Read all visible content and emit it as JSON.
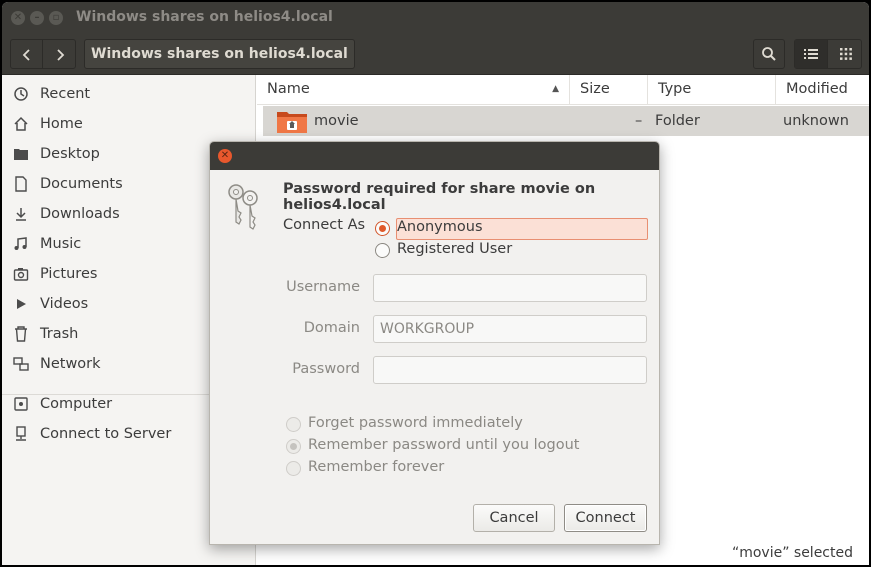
{
  "window": {
    "title": "Windows shares on helios4.local"
  },
  "toolbar": {
    "back_icon": "chevron-left-icon",
    "forward_icon": "chevron-right-icon",
    "path_label": "Windows shares on helios4.local",
    "search_icon": "search-icon",
    "list_view_icon": "list-view-icon",
    "grid_view_icon": "grid-view-icon"
  },
  "sidebar": {
    "items": [
      {
        "label": "Recent",
        "icon": "clock-icon"
      },
      {
        "label": "Home",
        "icon": "home-icon"
      },
      {
        "label": "Desktop",
        "icon": "folder-icon"
      },
      {
        "label": "Documents",
        "icon": "document-icon"
      },
      {
        "label": "Downloads",
        "icon": "download-icon"
      },
      {
        "label": "Music",
        "icon": "music-icon"
      },
      {
        "label": "Pictures",
        "icon": "camera-icon"
      },
      {
        "label": "Videos",
        "icon": "video-icon"
      },
      {
        "label": "Trash",
        "icon": "trash-icon"
      },
      {
        "label": "Network",
        "icon": "network-icon"
      },
      {
        "label": "Computer",
        "icon": "computer-icon"
      },
      {
        "label": "Connect to Server",
        "icon": "server-icon"
      }
    ]
  },
  "list": {
    "columns": [
      "Name",
      "Size",
      "Type",
      "Modified"
    ],
    "rows": [
      {
        "name": "movie",
        "size": "–",
        "type": "Folder",
        "modified": "unknown"
      }
    ],
    "status": "“movie” selected"
  },
  "dialog": {
    "heading": "Password required for share movie on helios4.local",
    "connect_as_label": "Connect As",
    "connect_as_options": [
      "Anonymous",
      "Registered User"
    ],
    "connect_as_selected": "Anonymous",
    "username_label": "Username",
    "username_value": "",
    "domain_label": "Domain",
    "domain_value": "WORKGROUP",
    "password_label": "Password",
    "password_value": "",
    "remember_options": [
      "Forget password immediately",
      "Remember password until you logout",
      "Remember forever"
    ],
    "remember_selected": "Remember password until you logout",
    "cancel_label": "Cancel",
    "connect_label": "Connect"
  },
  "colors": {
    "titlebar": "#3c3b37",
    "accent": "#e05a2b",
    "selection": "#d8d6d2"
  }
}
